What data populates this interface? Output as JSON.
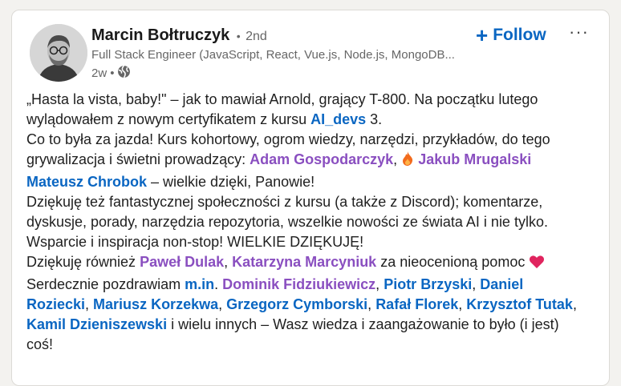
{
  "author": {
    "name": "Marcin Bołtruczyk",
    "dot": "•",
    "degree": "2nd",
    "headline": "Full Stack Engineer (JavaScript, React, Vue.js, Node.js, MongoDB...",
    "age": "2w",
    "visibility_dot": "•",
    "visibility_icon": "globe-icon"
  },
  "actions": {
    "follow_plus": "+",
    "follow_label": "Follow",
    "more_label": "···"
  },
  "colors": {
    "purple_mention": "#8a4fc0",
    "blue_mention": "#0a66c2"
  },
  "post": {
    "t1": "„Hasta la vista, baby!\" – jak to mawiał Arnold, grający T-800. Na początku lutego wylądowałem z nowym certyfikatem z kursu ",
    "link_aidevs": "AI_devs",
    "t2": " 3.",
    "t3": "Co to była za jazda! Kurs kohortowy, ogrom wiedzy, narzędzi, przykładów, do tego grywalizacja i świetni prowadzący: ",
    "m_adam": "Adam Gospodarczyk",
    "t4": ", ",
    "fire_icon": "fire-icon",
    "m_jakub": "Jakub Mrugalski",
    "m_mateusz": "Mateusz Chrobok",
    "t5": " – wielkie dzięki, Panowie!",
    "t6": "Dziękuję też fantastycznej społeczności z kursu (a także z Discord); komentarze, dyskusje, porady, narzędzia repozytoria, wszelkie nowości ze świata AI i nie tylko. Wsparcie i inspiracja non-stop! WIELKIE DZIĘKUJĘ!",
    "t7": "Dziękuję również ",
    "m_pawel": "Paweł Dulak",
    "sep1": ", ",
    "m_katarzyna": "Katarzyna Marcyniuk",
    "t8": " za nieocenioną pomoc ",
    "heart_icon": "heart-icon",
    "t9": "Serdecznie pozdrawiam ",
    "m_min": "m.in",
    "t10": ". ",
    "m_dominik": "Dominik Fidziukiewicz",
    "sep2": ", ",
    "m_piotr": "Piotr Brzyski",
    "sep3": ", ",
    "m_daniel": "Daniel Roziecki",
    "sep4": ", ",
    "m_mariusz": "Mariusz Korzekwa",
    "sep5": ", ",
    "m_grzegorz": "Grzegorz Cymborski",
    "sep6": ", ",
    "m_rafal": "Rafał Florek",
    "sep7": ", ",
    "m_krzysztof": "Krzysztof Tutak",
    "sep8": ", ",
    "m_kamil": "Kamil Dzieniszewski",
    "t11": " i wielu innych – Wasz wiedza i zaangażowanie to było (i jest) coś!"
  }
}
